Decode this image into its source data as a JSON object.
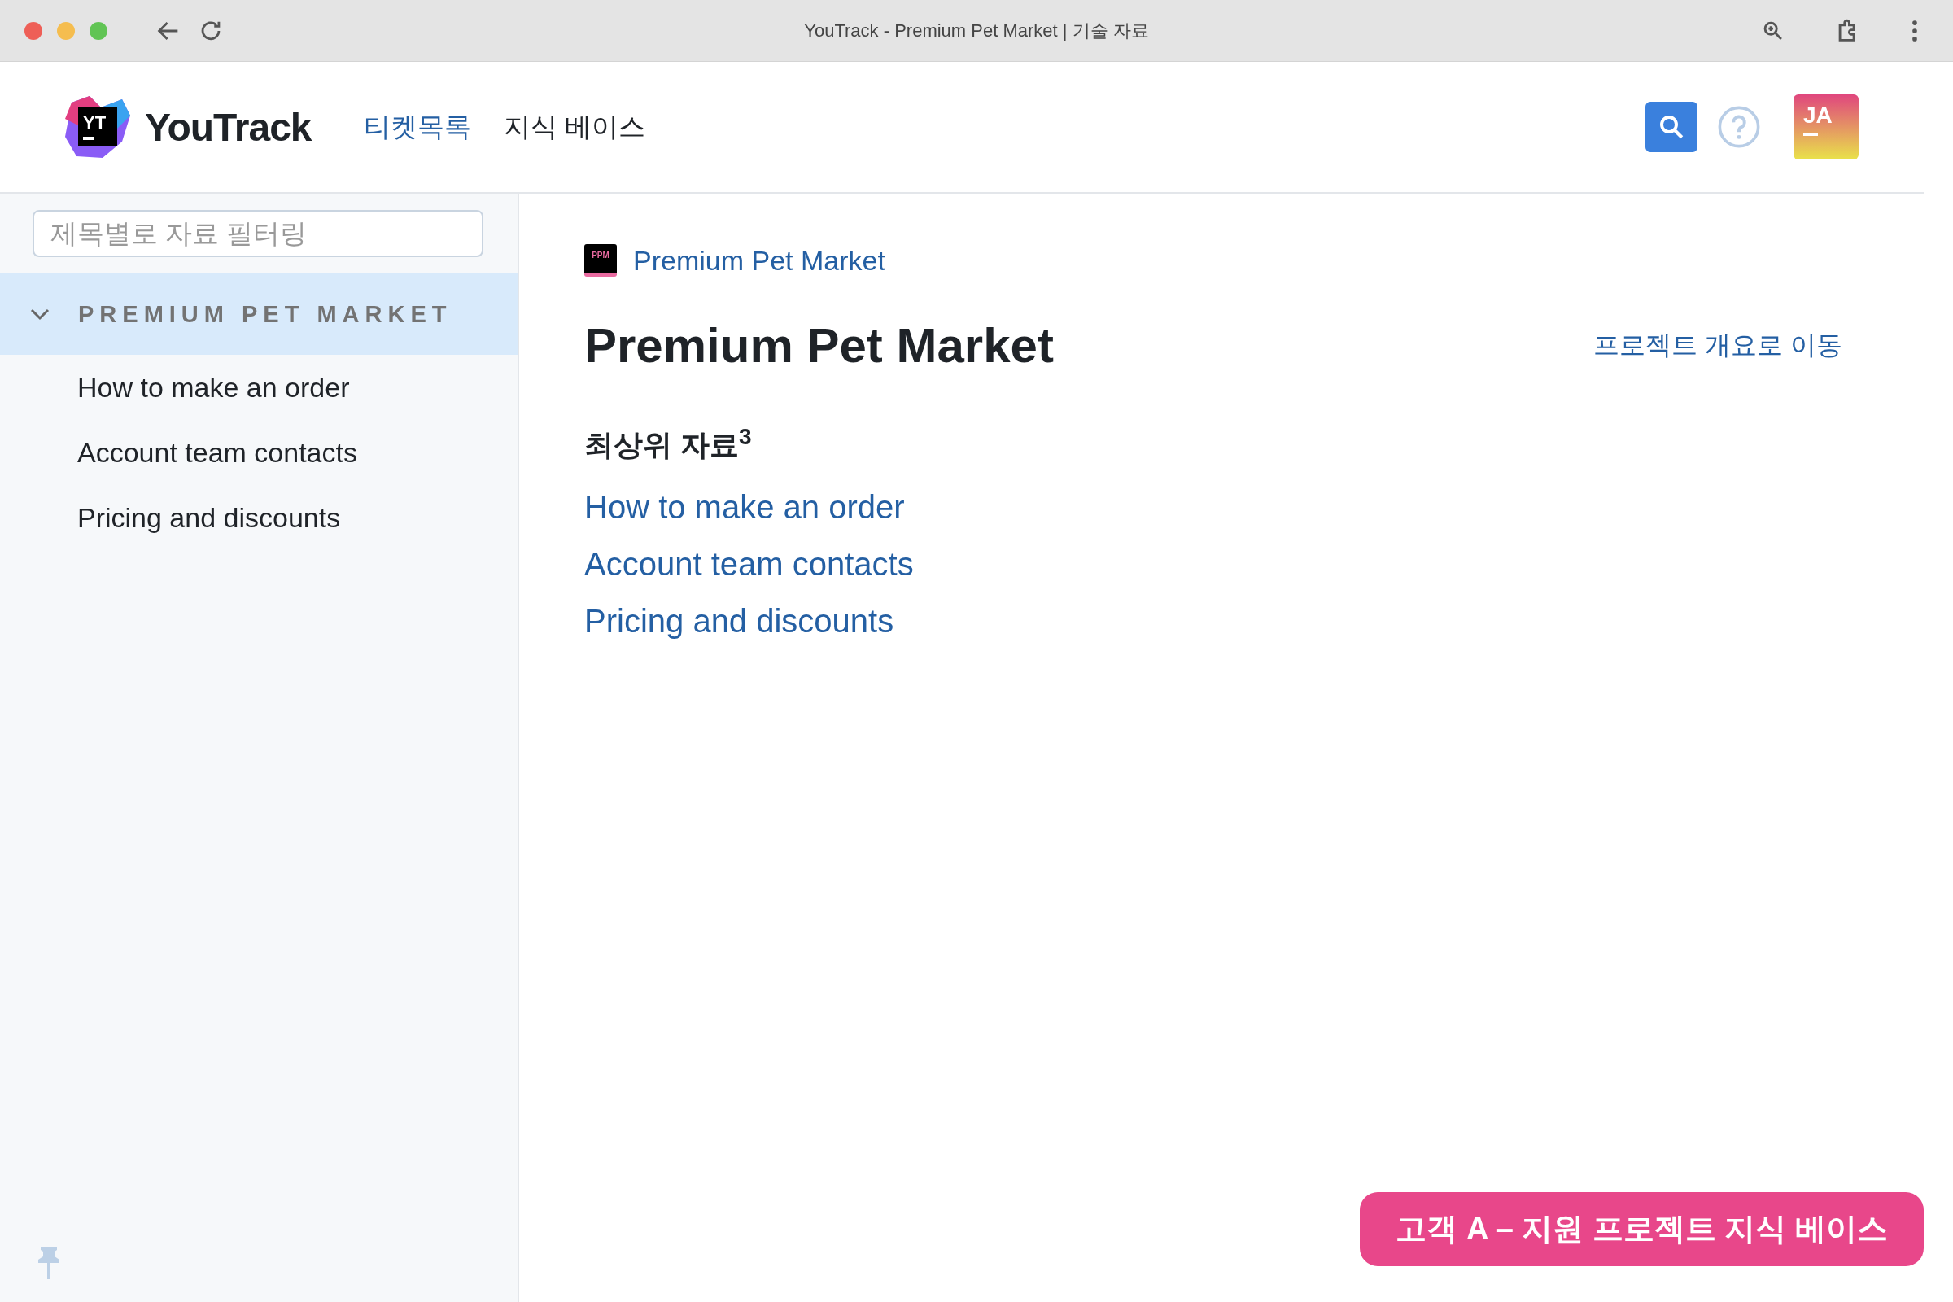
{
  "browser": {
    "title": "YouTrack - Premium Pet Market | 기술 자료"
  },
  "header": {
    "logo_mark": "YT",
    "logo_text": "YouTrack",
    "nav": [
      {
        "label": "티켓목록",
        "selected": false
      },
      {
        "label": "지식 베이스",
        "selected": true
      }
    ],
    "avatar": "JA"
  },
  "sidebar": {
    "filter": {
      "placeholder": "제목별로 자료 필터링"
    },
    "tree": [
      {
        "label": "PREMIUM PET MARKET",
        "expanded": true,
        "selected": true,
        "children": [
          {
            "label": "How to make an order",
            "selected": false
          },
          {
            "label": "Account team contacts",
            "selected": false
          },
          {
            "label": "Pricing and discounts",
            "selected": false
          }
        ]
      }
    ]
  },
  "content": {
    "breadcrumb": {
      "badge": "PPM",
      "label": "Premium Pet Market"
    },
    "title": "Premium Pet Market",
    "overview_link": "프로젝트 개요로 이동",
    "section": {
      "title": "최상위 자료",
      "count": "3"
    },
    "articles": [
      {
        "label": "How to make an order"
      },
      {
        "label": "Account team contacts"
      },
      {
        "label": "Pricing and discounts"
      }
    ]
  },
  "banner": "고객 A – 지원 프로젝트 지식 베이스"
}
